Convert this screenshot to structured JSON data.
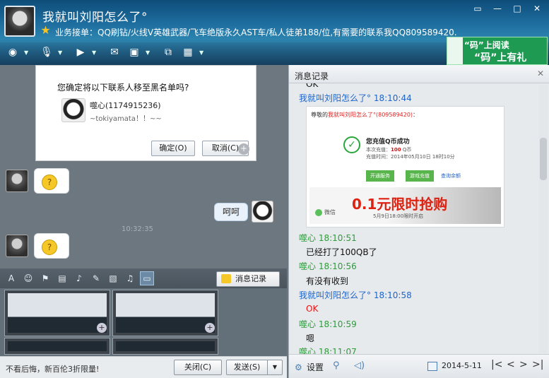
{
  "window": {
    "title": "我就叫刘阳怎么了°",
    "status": "业务接单：QQ刷钻/火线V英雄武器/飞车绝版永久AST车/私人徒弟188/位,有需要的联系我QQ809589420.",
    "controls": [
      "▭",
      "—",
      "□",
      "✕"
    ]
  },
  "top_toolbar": {
    "icons": [
      "webcam-icon",
      "mic-icon",
      "file-transfer-icon",
      "sms-icon",
      "remote-desktop-icon",
      "share-screen-icon",
      "apps-icon"
    ]
  },
  "ad_banner": {
    "line1": "“码”上阅读",
    "line2": "“码”上有礼"
  },
  "dialog": {
    "question": "您确定将以下联系人移至黑名单吗?",
    "contact_name": "噬心(1174915236)",
    "contact_sig": "~tokiyamata！！~~",
    "ok_label": "确定(O)",
    "cancel_label": "取消(C)"
  },
  "chat": {
    "my_message": "呵呵",
    "timestamp": "10:32:35"
  },
  "input_toolbar": {
    "icons": [
      "font-icon",
      "emoji-icon",
      "shake-icon",
      "screenshot-icon",
      "voice-icon",
      "note-icon",
      "image-icon",
      "music-icon",
      "scene-icon"
    ],
    "message_record_label": "消息记录"
  },
  "bottom": {
    "ad_text": "不看后悔，新百伦3折限量!",
    "close_label": "关闭(C)",
    "send_label": "发送(S)"
  },
  "record_panel": {
    "title": "消息记录",
    "top_cut": "OK",
    "entries": [
      {
        "sender": "我就叫刘阳怎么了° 18:10:44",
        "type": "me"
      },
      {
        "sender": "噬心 18:10:51",
        "type": "other",
        "message": "已经打了100QB了"
      },
      {
        "sender": "噬心 18:10:56",
        "type": "other",
        "message": "有没有收到"
      },
      {
        "sender": "我就叫刘阳怎么了° 18:10:58",
        "type": "me",
        "message": "OK"
      },
      {
        "sender": "噬心 18:10:59",
        "type": "other",
        "message": "嗯"
      },
      {
        "sender": "噬心 18:11:07",
        "type": "other"
      }
    ],
    "image": {
      "greeting_prefix": "尊敬的",
      "greeting_name": "我就叫刘阳怎么了°(809589420)",
      "greeting_suffix": "：",
      "success": "您充值Q币成功",
      "amount_prefix": "本次充值：",
      "amount_value": "100",
      "amount_unit": " Q币",
      "time": "充值时间：2014年05月10日 18时10分",
      "btn1": "开通服务",
      "btn2": "游戏充值",
      "link": "查询余额",
      "ad_text": "0.1元限时抢购",
      "ad_sub": "5月9日18:00限时开启",
      "wechat": "微信"
    },
    "footer": {
      "settings_label": "设置",
      "date": "2014-5-11",
      "nav": [
        "|<",
        "<",
        ">",
        ">|"
      ]
    }
  }
}
